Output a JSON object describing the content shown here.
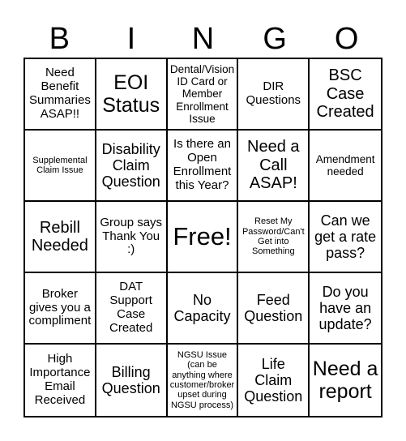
{
  "header": {
    "letters": [
      "B",
      "I",
      "N",
      "G",
      "O"
    ]
  },
  "board": {
    "rows": [
      [
        {
          "text": "Need Benefit Summaries ASAP!!"
        },
        {
          "text": "EOI Status"
        },
        {
          "text": "Dental/Vision ID Card or Member Enrollment Issue"
        },
        {
          "text": "DIR Questions"
        },
        {
          "text": "BSC Case Created"
        }
      ],
      [
        {
          "text": "Supplemental Claim Issue"
        },
        {
          "text": "Disability Claim Question"
        },
        {
          "text": "Is there an Open Enrollment this Year?"
        },
        {
          "text": "Need a Call ASAP!"
        },
        {
          "text": "Amendment needed"
        }
      ],
      [
        {
          "text": "Rebill Needed"
        },
        {
          "text": "Group says Thank You :)"
        },
        {
          "text": "Free!"
        },
        {
          "text": "Reset My Password/Can't Get into Something"
        },
        {
          "text": "Can we get a rate pass?"
        }
      ],
      [
        {
          "text": "Broker gives you a compliment"
        },
        {
          "text": "DAT Support Case Created"
        },
        {
          "text": "No Capacity"
        },
        {
          "text": "Feed Question"
        },
        {
          "text": "Do you have an update?"
        }
      ],
      [
        {
          "text": "High Importance Email Received"
        },
        {
          "text": "Billing Question"
        },
        {
          "text": "NGSU Issue (can be anything where customer/broker upset during NGSU process)"
        },
        {
          "text": "Life Claim Question"
        },
        {
          "text": "Need a report"
        }
      ]
    ]
  }
}
